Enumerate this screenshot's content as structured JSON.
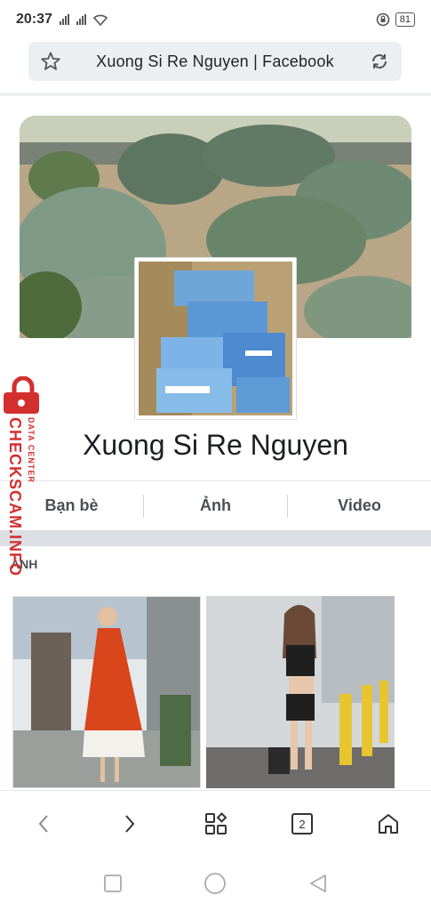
{
  "status_bar": {
    "time": "20:37",
    "battery": "81"
  },
  "address_bar": {
    "title": "Xuong Si Re Nguyen | Facebook"
  },
  "profile": {
    "page_name": "Xuong Si Re Nguyen"
  },
  "tabs": [
    {
      "label": "Bạn bè"
    },
    {
      "label": "Ảnh"
    },
    {
      "label": "Video"
    }
  ],
  "photos_section": {
    "title": "ẢNH"
  },
  "bottom_nav": {
    "tab_count": "2"
  },
  "watermark": {
    "main": "CHECKSCAM.INFO",
    "sub": "DATA CENTER"
  },
  "colors": {
    "watermark": "#d32f2f",
    "tab_text": "#4b4f56"
  }
}
